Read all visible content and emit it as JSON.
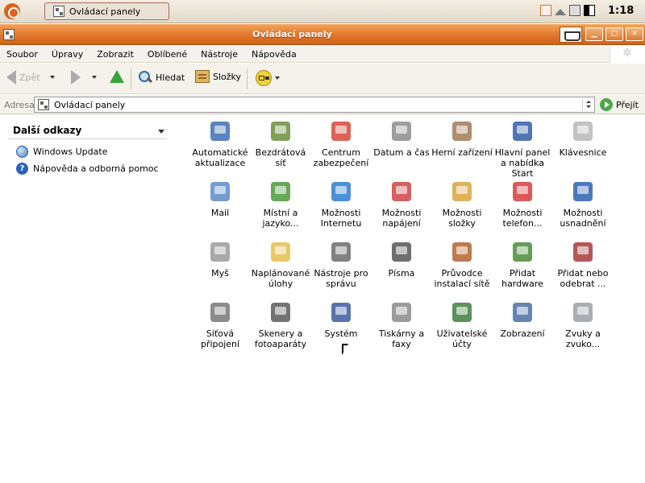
{
  "taskbar": {
    "task_title": "Ovládací panely",
    "clock": "1:18",
    "tray_icons": [
      "network-icon",
      "eject-icon",
      "printer-icon",
      "display-icon"
    ]
  },
  "window": {
    "title": "Ovládací panely"
  },
  "menu": {
    "items": [
      "Soubor",
      "Úpravy",
      "Zobrazit",
      "Oblíbené",
      "Nástroje",
      "Nápověda"
    ]
  },
  "toolbar": {
    "back_label": "Zpět",
    "search_label": "Hledat",
    "folders_label": "Složky"
  },
  "address": {
    "label": "Adresa",
    "value": "Ovládací panely",
    "go_label": "Přejít"
  },
  "sidebar": {
    "title": "Další odkazy",
    "links": [
      "Windows Update",
      "Nápověda a odborná pomoc"
    ]
  },
  "icons": [
    {
      "name": "automatic-updates-icon",
      "label": "Automatické aktualizace",
      "color": "#3d6fb6"
    },
    {
      "name": "wireless-icon",
      "label": "Bezdrátová síť",
      "color": "#6b8f3a"
    },
    {
      "name": "security-center-icon",
      "label": "Centrum zabezpečení",
      "color": "#d9463a"
    },
    {
      "name": "date-time-icon",
      "label": "Datum a čas",
      "color": "#8c8c8c"
    },
    {
      "name": "game-controllers-icon",
      "label": "Herní zařízení",
      "color": "#a07a56"
    },
    {
      "name": "taskbar-start-icon",
      "label": "Hlavní panel a nabídka Start",
      "color": "#2f5ea8"
    },
    {
      "name": "keyboard-icon",
      "label": "Klávesnice",
      "color": "#b6b6b6"
    },
    {
      "name": "mail-icon",
      "label": "Mail",
      "color": "#5a8bc9"
    },
    {
      "name": "regional-language-icon",
      "label": "Místní a jazyko...",
      "color": "#4a9a3a"
    },
    {
      "name": "internet-options-icon",
      "label": "Možnosti Internetu",
      "color": "#2c7bd3"
    },
    {
      "name": "power-options-icon",
      "label": "Možnosti napájení",
      "color": "#c44"
    },
    {
      "name": "folder-options-icon",
      "label": "Možnosti složky",
      "color": "#d8a43e"
    },
    {
      "name": "phone-modem-icon",
      "label": "Možnosti telefon...",
      "color": "#d63c3c"
    },
    {
      "name": "accessibility-icon",
      "label": "Možnosti usnadnění",
      "color": "#2d62b1"
    },
    {
      "name": "mouse-icon",
      "label": "Myš",
      "color": "#9a9a9a"
    },
    {
      "name": "scheduled-tasks-icon",
      "label": "Naplánované úlohy",
      "color": "#e3bf4d"
    },
    {
      "name": "admin-tools-icon",
      "label": "Nástroje pro správu",
      "color": "#6b6b6b"
    },
    {
      "name": "fonts-icon",
      "label": "Písma",
      "color": "#555"
    },
    {
      "name": "network-setup-wizard-icon",
      "label": "Průvodce instalací sítě",
      "color": "#b5632e"
    },
    {
      "name": "add-hardware-icon",
      "label": "Přidat hardware",
      "color": "#4a8c3a"
    },
    {
      "name": "add-remove-programs-icon",
      "label": "Přidat nebo odebrat ...",
      "color": "#a83a3a"
    },
    {
      "name": "network-connections-icon",
      "label": "Síťová připojení",
      "color": "#777"
    },
    {
      "name": "scanners-cameras-icon",
      "label": "Skenery a fotoaparáty",
      "color": "#5a5a5a"
    },
    {
      "name": "system-icon",
      "label": "Systém",
      "color": "#3c5aa0"
    },
    {
      "name": "printers-faxes-icon",
      "label": "Tiskárny a faxy",
      "color": "#8a8a8a"
    },
    {
      "name": "user-accounts-icon",
      "label": "Uživatelské účty",
      "color": "#3d7f3d"
    },
    {
      "name": "display-settings-icon",
      "label": "Zobrazení",
      "color": "#4a6fa5"
    },
    {
      "name": "sounds-audio-icon",
      "label": "Zvuky a zvuko...",
      "color": "#9aa0a8"
    }
  ]
}
